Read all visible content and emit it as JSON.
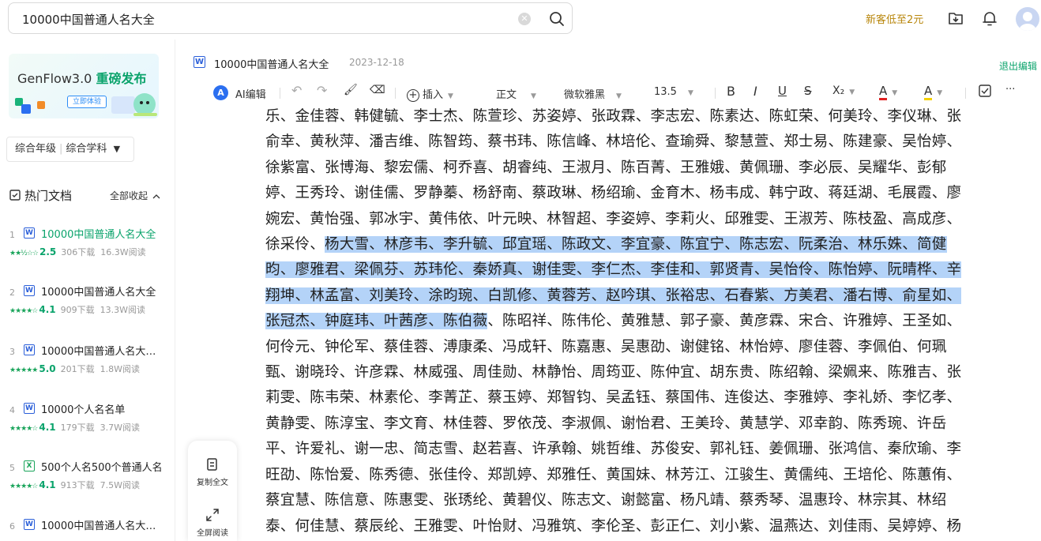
{
  "search": {
    "value": "10000中国普通人名大全",
    "clear_icon": "clear-icon",
    "search_icon": "search-icon"
  },
  "header": {
    "promo": "新客低至2元"
  },
  "sidebar": {
    "banner": {
      "title_main": "GenFlow3.0 ",
      "title_highlight": "重磅发布",
      "button": "立即体验"
    },
    "grade": {
      "grade": "综合年级",
      "subject": "综合学科",
      "caret": "▼"
    },
    "hot": {
      "title": "热门文档",
      "collapse": "全部收起",
      "collapse_icon": "chevron-up-icon"
    },
    "docs": [
      {
        "rank": "1",
        "badge": "W",
        "title": "10000中国普通人名大全",
        "stars": "★★½☆☆",
        "score": "2.5",
        "downloads": "306下载",
        "reads": "16.3W阅读",
        "active": true
      },
      {
        "rank": "2",
        "badge": "W",
        "title": "10000中国普通人名大全",
        "stars": "★★★★☆",
        "score": "4.1",
        "downloads": "909下载",
        "reads": "13.3W阅读",
        "active": false
      },
      {
        "rank": "3",
        "badge": "W",
        "title": "10000中国普通人名大…",
        "stars": "★★★★★",
        "score": "5.0",
        "downloads": "201下载",
        "reads": "1.8W阅读",
        "active": false
      },
      {
        "rank": "4",
        "badge": "W",
        "title": "10000个人名名单",
        "stars": "★★★★☆",
        "score": "4.1",
        "downloads": "179下载",
        "reads": "3.7W阅读",
        "active": false
      },
      {
        "rank": "5",
        "badge": "X",
        "title": "500个人名500个普通人名",
        "stars": "★★★★☆",
        "score": "4.1",
        "downloads": "913下载",
        "reads": "7.5W阅读",
        "active": false
      },
      {
        "rank": "6",
        "badge": "W",
        "title": "10000中国普通人名大…",
        "stars": "",
        "score": "",
        "downloads": "",
        "reads": "",
        "active": false
      }
    ]
  },
  "float_tools": {
    "copy": "复制全文",
    "fullscreen": "全屏阅读"
  },
  "document": {
    "badge": "W",
    "title": "10000中国普通人名大全",
    "date": "2023-12-18",
    "exit_edit": "退出编辑"
  },
  "toolbar": {
    "ai": "AI编辑",
    "ai_badge": "A",
    "undo": "↶",
    "redo": "↷",
    "format_painter": "🖌",
    "eraser": "⌫",
    "insert": "插入",
    "style": "正文",
    "font": "微软雅黑",
    "size": "13.5",
    "bold": "B",
    "italic": "I",
    "underline": "U",
    "strike": "S",
    "subscript": "X₂",
    "font_color": "A",
    "highlight": "A",
    "more": "···"
  },
  "content": {
    "lines": [
      {
        "text": "乐、金佳蓉、韩健毓、李士杰、陈萱珍、苏姿婷、张政霖、李志宏、陈素达、陈虹荣、何美玲、李仪琳、张"
      },
      {
        "text": "俞幸、黄秋萍、潘吉维、陈智筠、蔡书玮、陈信峰、林培伦、查瑜舜、黎慧萱、郑士易、陈建豪、吴怡婷、"
      },
      {
        "text": "徐紫富、张博海、黎宏儒、柯乔喜、胡睿纯、王淑月、陈百菁、王雅娥、黄佩珊、李必辰、吴耀华、彭郁"
      },
      {
        "text": "婷、王秀玲、谢佳儒、罗静蓁、杨舒南、蔡政琳、杨绍瑜、金育木、杨韦成、韩宁政、蒋廷湖、毛展霞、廖"
      },
      {
        "text": "婉宏、黄怡强、郭冰宇、黄伟依、叶元映、林智超、李姿婷、李莉火、邱雅雯、王淑芳、陈枝盈、高成彦、"
      },
      {
        "pre": "徐采伶、",
        "sel": "杨大雪、林彦韦、李升毓、邱宜瑶、陈政文、李宜豪、陈宜宁、陈志宏、阮柔治、林乐姝、简健"
      },
      {
        "sel": "昀、廖雅君、梁佩芬、苏玮伦、秦娇真、谢佳雯、李仁杰、李佳和、郭贤青、吴怡伶、陈怡婷、阮晴桦、辛"
      },
      {
        "sel": "翔坤、林孟富、刘美玲、涂昀琬、白凯修、黄蓉芳、赵吟琪、张裕忠、石春紫、方美君、潘右博、俞星如、"
      },
      {
        "sel": "张冠杰、钟庭玮、叶茜彦、陈伯薇",
        "post": "、陈昭祥、陈伟伦、黄雅慧、郭子豪、黄彦霖、宋合、许雅婷、王圣如、"
      },
      {
        "text": "何伶元、钟伦军、蔡佳蓉、溥康柔、冯成轩、陈嘉惠、吴惠劭、谢健铭、林怡婷、廖佳蓉、李佩伯、何珮"
      },
      {
        "text": "甄、谢晓玲、许彦霖、林威强、周佳勋、林静怡、周筠亚、陈仲宜、胡东贵、陈绍翰、梁姵来、陈雅吉、张"
      },
      {
        "text": "莉雯、陈韦荣、林素伦、李菁芷、蔡玉婷、郑智钧、吴孟钰、蔡国伟、连俊达、李雅婷、李礼娇、李忆孝、"
      },
      {
        "text": "黄静雯、陈淳宝、李文育、林佳蓉、罗依茂、李淑佩、谢怡君、王美玲、黄慧学、邓幸韵、陈秀琬、许岳"
      },
      {
        "text": "平、许爱礼、谢一忠、简志雪、赵若喜、许承翰、姚哲维、苏俊安、郭礼钰、姜佩珊、张鸿信、秦欣瑜、李"
      },
      {
        "text": "旺劭、陈怡爱、陈秀德、张佳伶、郑凯婷、郑雅任、黄国妹、林芳江、江骏生、黄儒纯、王培伦、陈蕙侑、"
      },
      {
        "text": "蔡宜慧、陈信意、陈惠雯、张琇纶、黄碧仪、陈志文、谢懿富、杨凡靖、蔡秀琴、温惠玲、林宗其、林绍"
      },
      {
        "text": "泰、何佳慧、蔡辰纶、王雅雯、叶怡财、冯雅筑、李伦圣、彭正仁、刘小紫、温燕达、刘佳雨、吴婷婷、杨"
      }
    ]
  }
}
